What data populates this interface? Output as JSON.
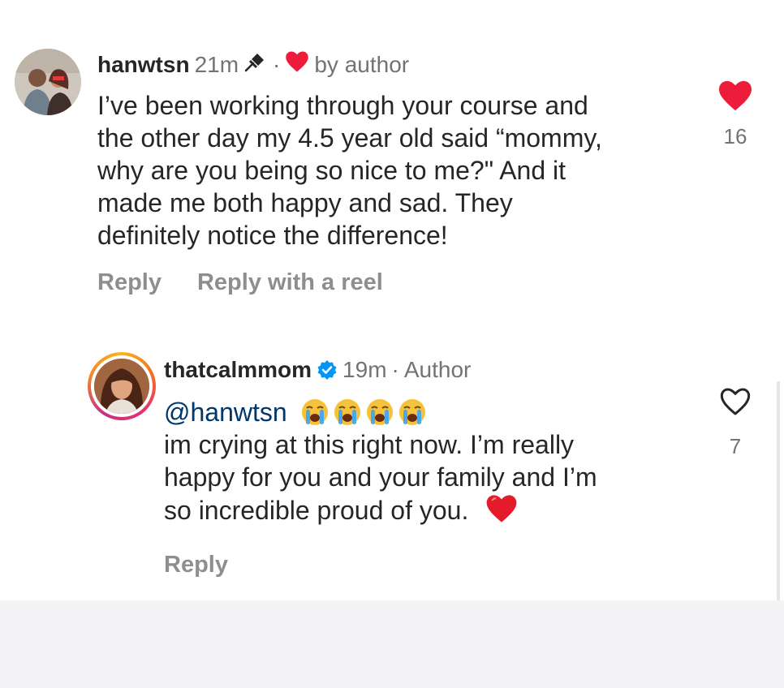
{
  "comments": [
    {
      "username": "hanwtsn",
      "time": "21m",
      "separator": "·",
      "liked_by": "by author",
      "lines": [
        "I’ve been working through your course and",
        "the other day my 4.5 year old said “mommy,",
        "why are you being so nice to me?\" And it",
        "made me both happy and sad. They",
        "definitely notice the difference!"
      ],
      "actions": {
        "reply": "Reply",
        "reply_reel": "Reply with a reel"
      },
      "like_count": "16",
      "liked": true,
      "icons": [
        "pin-icon",
        "heart-icon"
      ]
    },
    {
      "username": "thatcalmmom",
      "time": "19m",
      "separator": "·",
      "role": "Author",
      "mention": "@hanwtsn",
      "lines": [
        "im crying at this right now. I’m really",
        "happy for you and your family and I’m",
        "so incredible proud of you."
      ],
      "actions": {
        "reply": "Reply"
      },
      "like_count": "7",
      "liked": false,
      "icons": [
        "verified-badge-icon",
        "loudly-crying-emoji-icon",
        "red-heart-emoji-icon"
      ]
    }
  ],
  "colors": {
    "heart_red": "#ed1c3b",
    "verified_blue": "#0095f6",
    "mention_blue": "#00376b",
    "secondary_text": "#737373"
  }
}
